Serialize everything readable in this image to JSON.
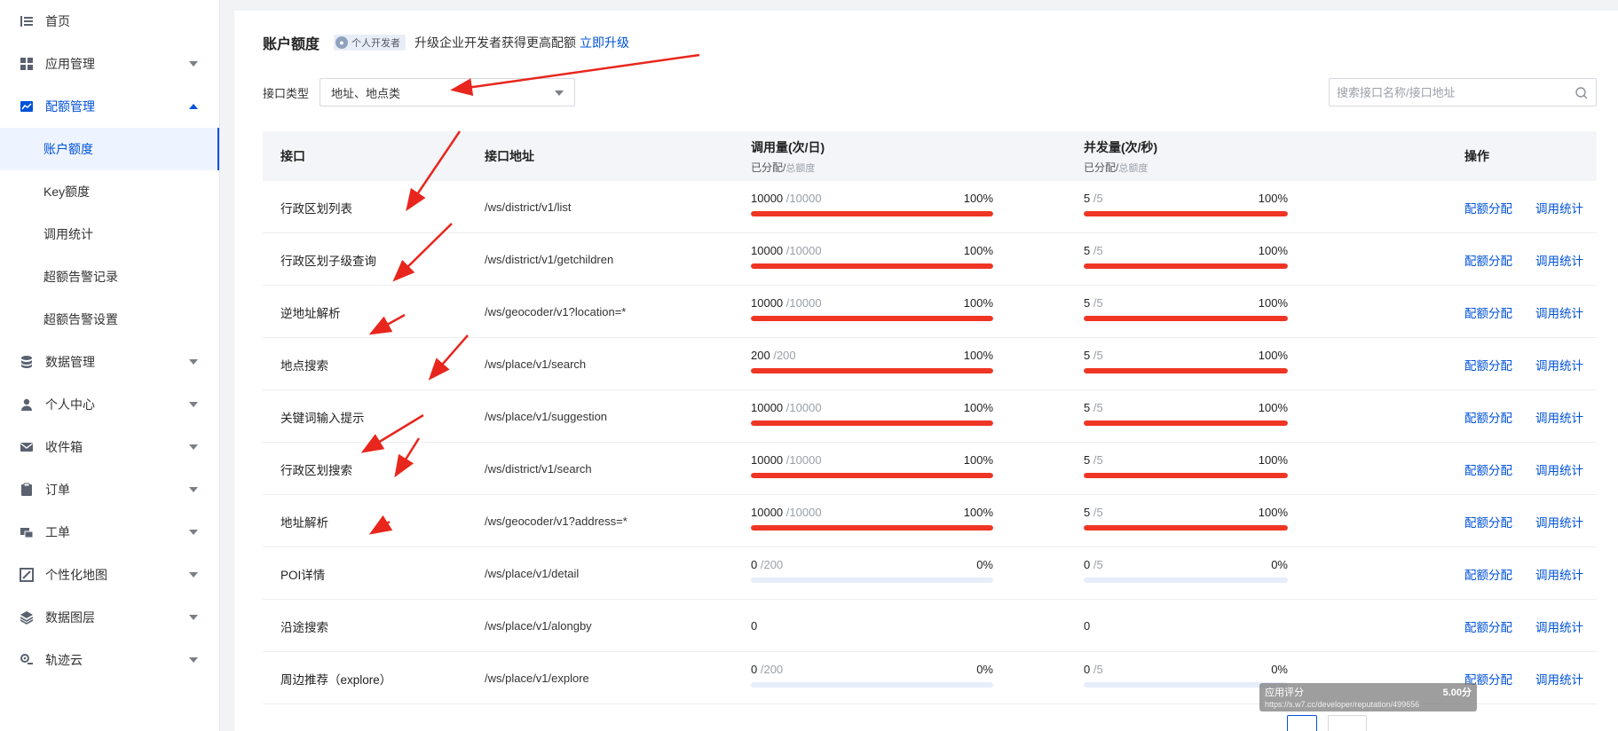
{
  "sidebar": {
    "items": [
      {
        "label": "首页",
        "icon": "list-icon",
        "has_caret": false
      },
      {
        "label": "应用管理",
        "icon": "grid-icon",
        "has_caret": true
      },
      {
        "label": "配额管理",
        "icon": "chart-icon",
        "has_caret": true,
        "active": true,
        "expanded": true
      },
      {
        "label": "数据管理",
        "icon": "database-icon",
        "has_caret": true
      },
      {
        "label": "个人中心",
        "icon": "user-icon",
        "has_caret": true
      },
      {
        "label": "收件箱",
        "icon": "mail-icon",
        "has_caret": true
      },
      {
        "label": "订单",
        "icon": "clipboard-icon",
        "has_caret": true
      },
      {
        "label": "工单",
        "icon": "ticket-icon",
        "has_caret": true
      },
      {
        "label": "个性化地图",
        "icon": "map-icon",
        "has_caret": true
      },
      {
        "label": "数据图层",
        "icon": "layers-icon",
        "has_caret": true
      },
      {
        "label": "轨迹云",
        "icon": "track-icon",
        "has_caret": true
      }
    ],
    "sub_items": [
      "账户额度",
      "Key额度",
      "调用统计",
      "超额告警记录",
      "超额告警设置"
    ],
    "selected_sub": "账户额度"
  },
  "header": {
    "title": "账户额度",
    "badge": "个人开发者",
    "upgrade_text": "升级企业开发者获得更高配额",
    "upgrade_link": "立即升级"
  },
  "filter": {
    "label": "接口类型",
    "selected": "地址、地点类"
  },
  "search": {
    "placeholder": "搜索接口名称/接口地址"
  },
  "table": {
    "columns": {
      "api": "接口",
      "address": "接口地址",
      "calls": "调用量(次/日)",
      "calls_sub_a": "已分配/",
      "calls_sub_b": "总额度",
      "concurrency": "并发量(次/秒)",
      "conc_sub_a": "已分配/",
      "conc_sub_b": "总额度",
      "ops": "操作"
    },
    "op_allocate": "配额分配",
    "op_stats": "调用统计",
    "rows": [
      {
        "name": "行政区划列表",
        "addr": "/ws/district/v1/list",
        "call_used": "10000",
        "call_total": "/10000",
        "call_pct": "100%",
        "call_ratio": 1.0,
        "conc_used": "5",
        "conc_total": "/5",
        "conc_pct": "100%",
        "conc_ratio": 1.0
      },
      {
        "name": "行政区划子级查询",
        "addr": "/ws/district/v1/getchildren",
        "call_used": "10000",
        "call_total": "/10000",
        "call_pct": "100%",
        "call_ratio": 1.0,
        "conc_used": "5",
        "conc_total": "/5",
        "conc_pct": "100%",
        "conc_ratio": 1.0
      },
      {
        "name": "逆地址解析",
        "addr": "/ws/geocoder/v1?location=*",
        "call_used": "10000",
        "call_total": "/10000",
        "call_pct": "100%",
        "call_ratio": 1.0,
        "conc_used": "5",
        "conc_total": "/5",
        "conc_pct": "100%",
        "conc_ratio": 1.0
      },
      {
        "name": "地点搜索",
        "addr": "/ws/place/v1/search",
        "call_used": "200",
        "call_total": "/200",
        "call_pct": "100%",
        "call_ratio": 1.0,
        "conc_used": "5",
        "conc_total": "/5",
        "conc_pct": "100%",
        "conc_ratio": 1.0
      },
      {
        "name": "关键词输入提示",
        "addr": "/ws/place/v1/suggestion",
        "call_used": "10000",
        "call_total": "/10000",
        "call_pct": "100%",
        "call_ratio": 1.0,
        "conc_used": "5",
        "conc_total": "/5",
        "conc_pct": "100%",
        "conc_ratio": 1.0
      },
      {
        "name": "行政区划搜索",
        "addr": "/ws/district/v1/search",
        "call_used": "10000",
        "call_total": "/10000",
        "call_pct": "100%",
        "call_ratio": 1.0,
        "conc_used": "5",
        "conc_total": "/5",
        "conc_pct": "100%",
        "conc_ratio": 1.0
      },
      {
        "name": "地址解析",
        "addr": "/ws/geocoder/v1?address=*",
        "call_used": "10000",
        "call_total": "/10000",
        "call_pct": "100%",
        "call_ratio": 1.0,
        "conc_used": "5",
        "conc_total": "/5",
        "conc_pct": "100%",
        "conc_ratio": 1.0
      },
      {
        "name": "POI详情",
        "addr": "/ws/place/v1/detail",
        "call_used": "0",
        "call_total": "/200",
        "call_pct": "0%",
        "call_ratio": 0.0,
        "conc_used": "0",
        "conc_total": "/5",
        "conc_pct": "0%",
        "conc_ratio": 0.0
      },
      {
        "name": "沿途搜索",
        "addr": "/ws/place/v1/alongby",
        "plain_call": "0",
        "plain_conc": "0"
      },
      {
        "name": "周边推荐（explore）",
        "addr": "/ws/place/v1/explore",
        "call_used": "0",
        "call_total": "/200",
        "call_pct": "0%",
        "call_ratio": 0.0,
        "conc_used": "0",
        "conc_total": "/5",
        "conc_pct": "0%",
        "conc_ratio": 0.0
      }
    ]
  },
  "tooltip": {
    "title": "应用评分",
    "score": "5.00分",
    "url": "https://s.w7.cc/developer/reputation/499656"
  },
  "colors": {
    "primary": "#0052d9",
    "bar_fill": "#ef3524",
    "bar_track": "#e6edfb",
    "annotation_arrow": "#e8261d"
  }
}
